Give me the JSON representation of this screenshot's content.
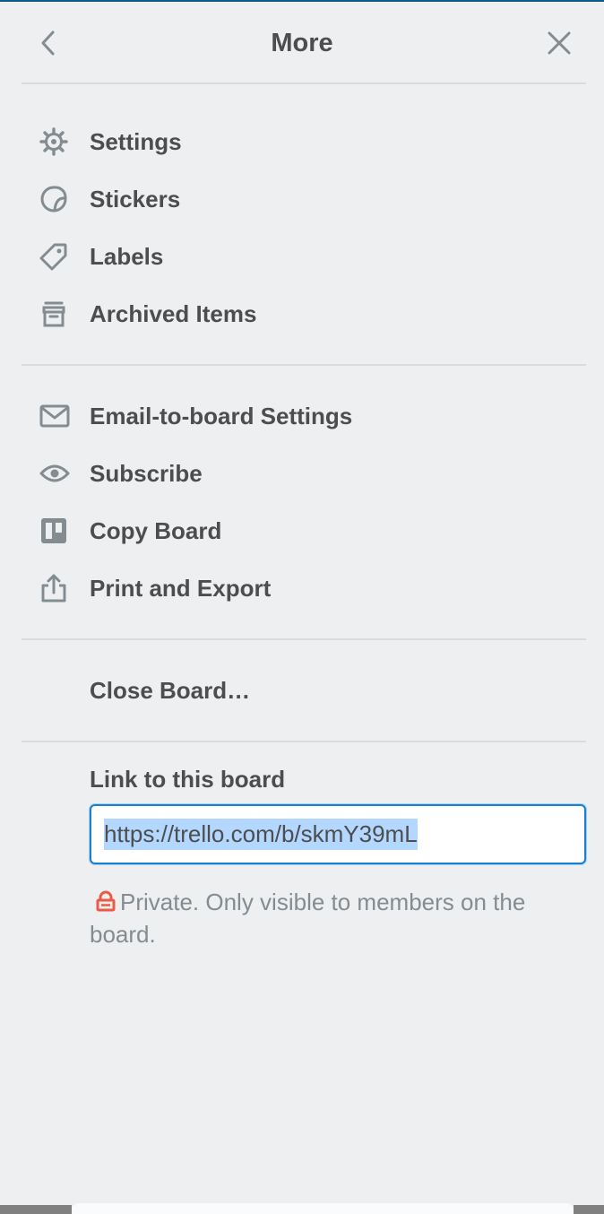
{
  "header": {
    "title": "More"
  },
  "menu_group_1": [
    {
      "label": "Settings",
      "icon": "gear-icon"
    },
    {
      "label": "Stickers",
      "icon": "sticker-icon"
    },
    {
      "label": "Labels",
      "icon": "tag-icon"
    },
    {
      "label": "Archived Items",
      "icon": "archive-icon"
    }
  ],
  "menu_group_2": [
    {
      "label": "Email-to-board Settings",
      "icon": "envelope-icon"
    },
    {
      "label": "Subscribe",
      "icon": "eye-icon"
    },
    {
      "label": "Copy Board",
      "icon": "board-icon"
    },
    {
      "label": "Print and Export",
      "icon": "share-icon"
    }
  ],
  "close_board": {
    "label": "Close Board…"
  },
  "link_section": {
    "heading": "Link to this board",
    "url": "https://trello.com/b/skmY39mL",
    "privacy_text": "Private. Only visible to members on the board."
  },
  "colors": {
    "background": "#edeff1",
    "text": "#4d4d4d",
    "muted": "#838c91",
    "focus_border": "#1e7fcf",
    "selection": "#b3d7ff",
    "lock": "#eb5a46"
  }
}
